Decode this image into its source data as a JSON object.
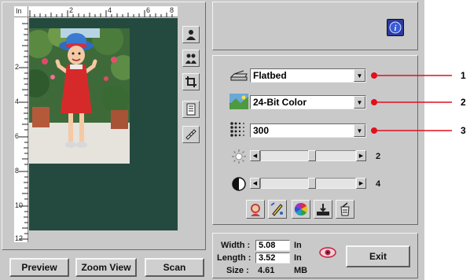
{
  "ruler": {
    "unit": "In",
    "top_ticks": [
      "2",
      "4",
      "6",
      "8"
    ],
    "left_ticks": [
      "2",
      "4",
      "6",
      "8",
      "10",
      "12"
    ]
  },
  "preview_buttons": {
    "preview": "Preview",
    "zoom_view": "Zoom View",
    "scan": "Scan"
  },
  "tools": [
    {
      "name": "auto-crop-icon"
    },
    {
      "name": "multi-crop-icon"
    },
    {
      "name": "crop-icon"
    },
    {
      "name": "document-icon"
    },
    {
      "name": "ruler-icon"
    }
  ],
  "settings": {
    "source": {
      "value": "Flatbed",
      "icon": "flatbed-icon"
    },
    "mode": {
      "value": "24-Bit Color",
      "icon": "color-photo-icon"
    },
    "resolution": {
      "value": "300",
      "icon": "resolution-icon"
    },
    "brightness": {
      "value": "2",
      "level": 0.62
    },
    "contrast": {
      "value": "4",
      "level": 0.62
    }
  },
  "image_tools": [
    {
      "name": "portrait-icon"
    },
    {
      "name": "pen-icon"
    },
    {
      "name": "color-wheel-icon"
    },
    {
      "name": "threshold-icon"
    },
    {
      "name": "filter-icon"
    }
  ],
  "callouts": [
    "1",
    "2",
    "3"
  ],
  "size_info": {
    "width_label": "Width :",
    "width_value": "5.08",
    "width_unit": "In",
    "length_label": "Length :",
    "length_value": "3.52",
    "length_unit": "In",
    "size_label": "Size :",
    "size_value": "4.61",
    "size_unit": "MB"
  },
  "exit": "Exit",
  "colors": {
    "preview_bg": "#244a3f",
    "callout_red": "#e0101c",
    "window_gray": "#c9c9c9"
  }
}
